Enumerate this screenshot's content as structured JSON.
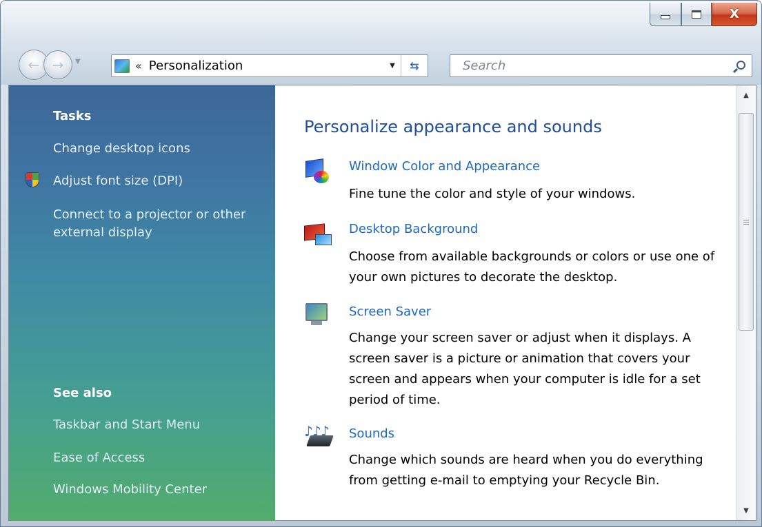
{
  "window": {
    "caption_buttons": {
      "minimize_icon": "minimize-icon",
      "maximize_icon": "maximize-icon",
      "close_glyph": "X"
    }
  },
  "nav": {
    "address_chevron": "«",
    "address_text": "Personalization",
    "refresh_glyph": "⇆",
    "search_placeholder": "Search"
  },
  "sidebar": {
    "tasks_heading": "Tasks",
    "tasks": [
      {
        "label": "Change desktop icons"
      },
      {
        "label": "Adjust font size (DPI)",
        "icon": "uac-shield-icon"
      },
      {
        "label": "Connect to a projector or other external display"
      }
    ],
    "see_also_heading": "See also",
    "see_also": [
      {
        "label": "Taskbar and Start Menu"
      },
      {
        "label": "Ease of Access"
      },
      {
        "label": "Windows Mobility Center"
      }
    ]
  },
  "main": {
    "title": "Personalize appearance and sounds",
    "items": [
      {
        "label": "Window Color and Appearance",
        "description": "Fine tune the color and style of your windows.",
        "icon": "window-color-icon"
      },
      {
        "label": "Desktop Background",
        "description": "Choose from available backgrounds or colors or use one of your own pictures to decorate the desktop.",
        "icon": "desktop-background-icon"
      },
      {
        "label": "Screen Saver",
        "description": "Change your screen saver or adjust when it displays. A screen saver is a picture or animation that covers your screen and appears when your computer is idle for a set period of time.",
        "icon": "screen-saver-icon"
      },
      {
        "label": "Sounds",
        "description": "Change which sounds are heard when you do everything from getting e-mail to emptying your Recycle Bin.",
        "icon": "sounds-icon"
      }
    ]
  },
  "colors": {
    "link": "#1c69bf",
    "title": "#1e4d9b",
    "sidebar_top": "#3c6798",
    "sidebar_bottom": "#52ac6c"
  }
}
